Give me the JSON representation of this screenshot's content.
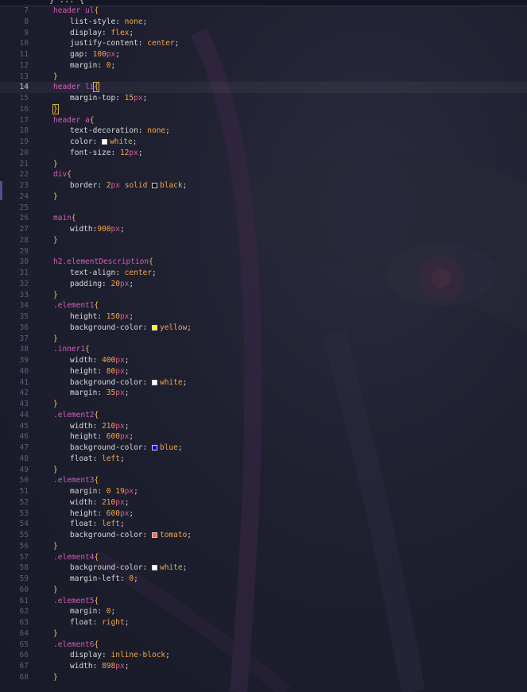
{
  "editor": {
    "partial_top_line": "} ... {",
    "colors": {
      "selector": "#d35dbb",
      "brace": "#f2c14e",
      "value": "#f6a54a",
      "unit": "#e05b8d",
      "property": "#dadada",
      "line_number": "#5a5f7a"
    },
    "current_line": 14,
    "lines": [
      {
        "n": "7",
        "sel": "header ul",
        "open": "{"
      },
      {
        "n": "8",
        "prop": "list-style:",
        "val": "none",
        "end": ";"
      },
      {
        "n": "9",
        "prop": "display:",
        "val": "flex",
        "end": ";"
      },
      {
        "n": "10",
        "prop": "justify-content:",
        "val": "center",
        "end": ";"
      },
      {
        "n": "11",
        "prop": "gap:",
        "val": "100",
        "unit": "px",
        "end": ";"
      },
      {
        "n": "12",
        "prop": "margin:",
        "val": "0",
        "end": ";"
      },
      {
        "n": "13",
        "close": "}"
      },
      {
        "n": "14",
        "sel": "header li",
        "open": "{",
        "current": true,
        "cursor": true
      },
      {
        "n": "15",
        "prop": "margin-top:",
        "val": "15",
        "unit": "px",
        "end": ";"
      },
      {
        "n": "16",
        "close": "}",
        "cursor": true
      },
      {
        "n": "17",
        "sel": "header a",
        "open": "{"
      },
      {
        "n": "18",
        "prop": "text-decoration:",
        "val": "none",
        "end": ";"
      },
      {
        "n": "19",
        "prop": "color:",
        "swatch": "#ffffff",
        "val": "white",
        "end": ";"
      },
      {
        "n": "20",
        "prop": "font-size:",
        "val": "12",
        "unit": "px",
        "end": ";"
      },
      {
        "n": "21",
        "close": "}"
      },
      {
        "n": "22",
        "sel": "div",
        "open": "{"
      },
      {
        "n": "23",
        "prop": "border:",
        "val": "2",
        "unit": "px",
        "rest": " solid ",
        "swatch": "#000000",
        "val2": "black",
        "end": ";"
      },
      {
        "n": "24",
        "close": "}"
      },
      {
        "n": "25"
      },
      {
        "n": "26",
        "sel": "main",
        "open": "{"
      },
      {
        "n": "27",
        "prop": "width:",
        "val": "900",
        "unit": "px",
        "end": ";",
        "tight": true
      },
      {
        "n": "28",
        "close": "}"
      },
      {
        "n": "29"
      },
      {
        "n": "30",
        "sel": "h2.elementDescription",
        "open": "{"
      },
      {
        "n": "31",
        "prop": "text-align:",
        "val": "center",
        "end": ";"
      },
      {
        "n": "32",
        "prop": "padding:",
        "val": "20",
        "unit": "px",
        "end": ";"
      },
      {
        "n": "33",
        "close": "}"
      },
      {
        "n": "34",
        "sel": ".element1",
        "open": "{"
      },
      {
        "n": "35",
        "prop": "height:",
        "val": "150",
        "unit": "px",
        "end": ";"
      },
      {
        "n": "36",
        "prop": "background-color:",
        "swatch": "#ffff00",
        "val": "yellow",
        "end": ";"
      },
      {
        "n": "37",
        "close": "}"
      },
      {
        "n": "38",
        "sel": ".inner1",
        "open": "{"
      },
      {
        "n": "39",
        "prop": "width:",
        "val": "400",
        "unit": "px",
        "end": ";"
      },
      {
        "n": "40",
        "prop": "height:",
        "val": "80",
        "unit": "px",
        "end": ";"
      },
      {
        "n": "41",
        "prop": "background-color:",
        "swatch": "#ffffff",
        "val": "white",
        "end": ";"
      },
      {
        "n": "42",
        "prop": "margin:",
        "val": "35",
        "unit": "px",
        "end": ";"
      },
      {
        "n": "43",
        "close": "}"
      },
      {
        "n": "44",
        "sel": ".element2",
        "open": "{"
      },
      {
        "n": "45",
        "prop": "width:",
        "val": "210",
        "unit": "px",
        "end": ";"
      },
      {
        "n": "46",
        "prop": "height:",
        "val": "600",
        "unit": "px",
        "end": ";"
      },
      {
        "n": "47",
        "prop": "background-color:",
        "swatch": "#0000ff",
        "val": "blue",
        "end": ";"
      },
      {
        "n": "48",
        "prop": "float:",
        "val": "left",
        "end": ";"
      },
      {
        "n": "49",
        "close": "}"
      },
      {
        "n": "50",
        "sel": ".element3",
        "open": "{"
      },
      {
        "n": "51",
        "prop": "margin:",
        "val": "0 19",
        "unit": "px",
        "end": ";"
      },
      {
        "n": "52",
        "prop": "width:",
        "val": "210",
        "unit": "px",
        "end": ";"
      },
      {
        "n": "53",
        "prop": "height:",
        "val": "600",
        "unit": "px",
        "end": ";"
      },
      {
        "n": "54",
        "prop": "float:",
        "val": "left",
        "end": ";"
      },
      {
        "n": "55",
        "prop": "background-color:",
        "swatch": "#ff6347",
        "val": "tomato",
        "end": ";"
      },
      {
        "n": "56",
        "close": "}"
      },
      {
        "n": "57",
        "sel": ".element4",
        "open": "{"
      },
      {
        "n": "58",
        "prop": "background-color:",
        "swatch": "#ffffff",
        "val": "white",
        "end": ";"
      },
      {
        "n": "59",
        "prop": "margin-left:",
        "val": "0",
        "end": ";"
      },
      {
        "n": "60",
        "close": "}"
      },
      {
        "n": "61",
        "sel": ".element5",
        "open": "{"
      },
      {
        "n": "62",
        "prop": "margin:",
        "val": "0",
        "end": ";"
      },
      {
        "n": "63",
        "prop": "float:",
        "val": "right",
        "end": ";"
      },
      {
        "n": "64",
        "close": "}"
      },
      {
        "n": "65",
        "sel": ".element6",
        "open": "{"
      },
      {
        "n": "66",
        "prop": "display:",
        "val": "inline-block",
        "end": ";"
      },
      {
        "n": "67",
        "prop": "width:",
        "val": "898",
        "unit": "px",
        "end": ";"
      },
      {
        "n": "68",
        "close": "}"
      }
    ]
  }
}
